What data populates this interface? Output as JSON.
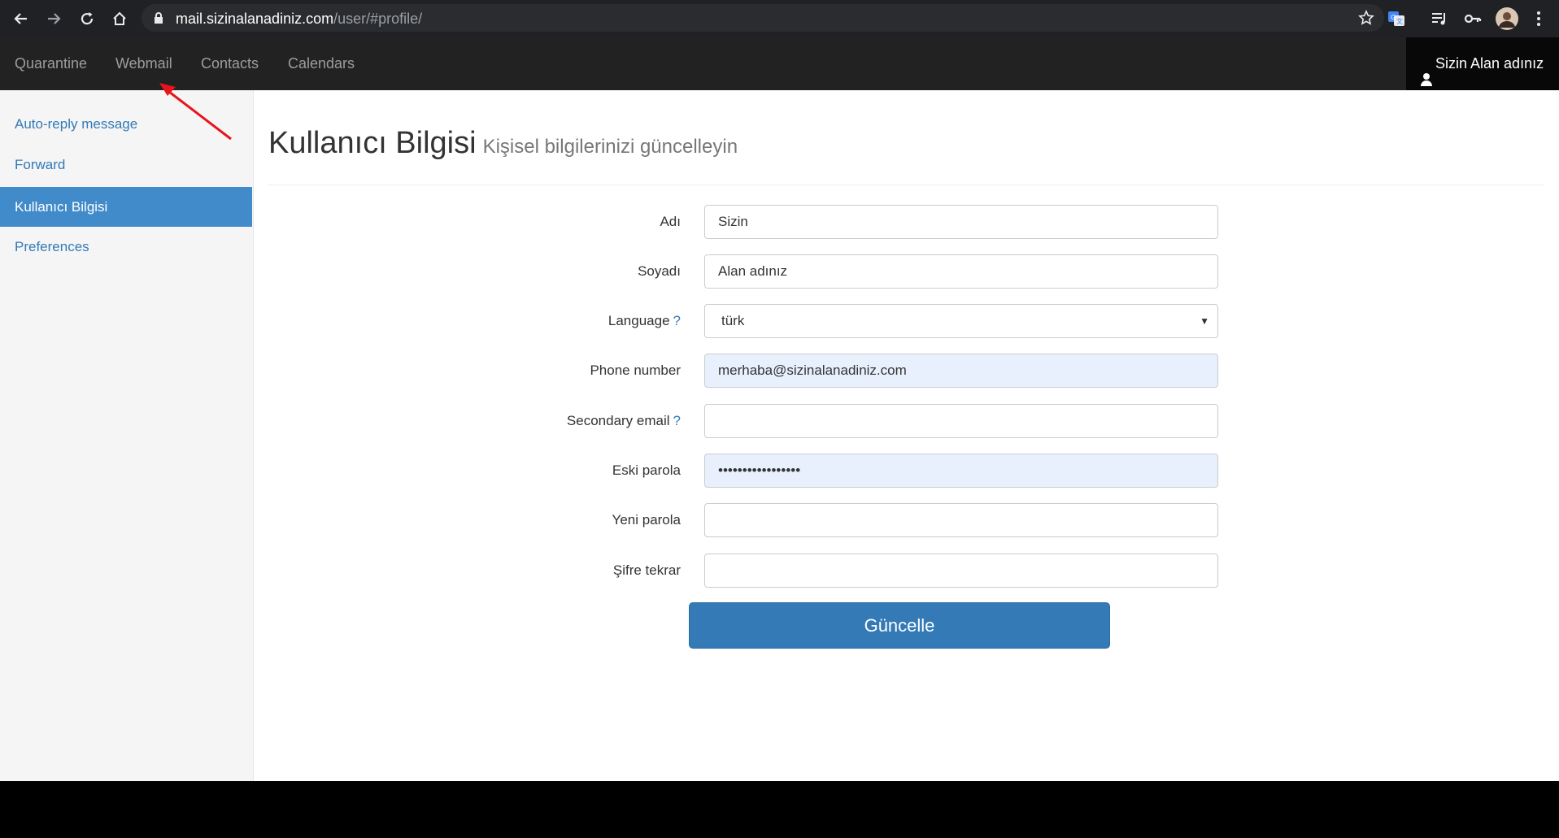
{
  "browser": {
    "url_host": "mail.sizinalanadiniz.com",
    "url_path": "/user/#profile/",
    "icons": [
      "back-icon",
      "forward-icon",
      "reload-icon",
      "home-icon",
      "lock-icon",
      "bookmark-star-icon",
      "translate-icon",
      "media-queue-icon",
      "key-icon",
      "profile-avatar",
      "kebab-menu-icon"
    ]
  },
  "navbar": {
    "items": [
      "Quarantine",
      "Webmail",
      "Contacts",
      "Calendars"
    ],
    "user_name": "Sizin Alan adınız",
    "user_icon": "user-icon"
  },
  "sidebar": {
    "items": [
      {
        "label": "Auto-reply message",
        "active": false
      },
      {
        "label": "Forward",
        "active": false
      },
      {
        "label": "Kullanıcı Bilgisi",
        "active": true
      },
      {
        "label": "Preferences",
        "active": false
      }
    ]
  },
  "page": {
    "title": "Kullanıcı Bilgisi",
    "subtitle": "Kişisel bilgilerinizi güncelleyin"
  },
  "form": {
    "first_name": {
      "label": "Adı",
      "value": "Sizin"
    },
    "last_name": {
      "label": "Soyadı",
      "value": "Alan adınız"
    },
    "language": {
      "label": "Language",
      "help": "?",
      "value": "türk"
    },
    "phone": {
      "label": "Phone number",
      "value": "merhaba@sizinalanadiniz.com"
    },
    "secondary_email": {
      "label": "Secondary email",
      "help": "?",
      "value": ""
    },
    "old_password": {
      "label": "Eski parola",
      "value": "•••••••••••••••••"
    },
    "new_password": {
      "label": "Yeni parola",
      "value": ""
    },
    "password_repeat": {
      "label": "Şifre tekrar",
      "value": ""
    },
    "submit_label": "Güncelle"
  },
  "colors": {
    "navbar_bg": "#222222",
    "accent": "#337ab7",
    "sidebar_active": "#428bca",
    "annotation_arrow": "#e8141b"
  }
}
